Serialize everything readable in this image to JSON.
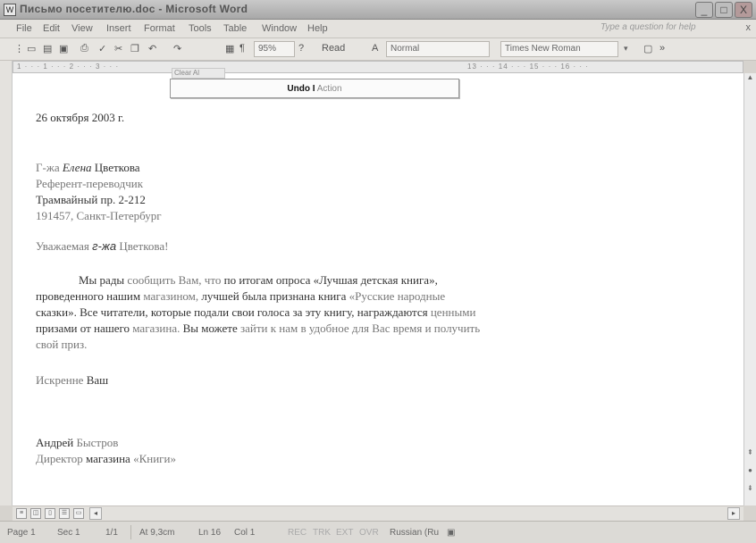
{
  "window": {
    "title": "Письмо посетителю.doc - Microsoft Word",
    "min": "_",
    "max": "□",
    "close": "X"
  },
  "menu": {
    "items": [
      "File",
      "Edit",
      "View",
      "Insert",
      "Format",
      "Tools",
      "Table",
      "Window",
      "Help"
    ],
    "help_placeholder": "Type a question for help",
    "close_glyph": "x"
  },
  "toolbar": {
    "zoom": "95%",
    "read_label": "Read",
    "style": "Normal",
    "font": "Times New Roman",
    "paragraph_mark": "¶"
  },
  "ruler": {
    "left_text": "1 · · · 1 · · · 2 · · · 3 · · ·",
    "right_text": "13 · · · 14 · · · 15 · · · 16 · · ·"
  },
  "undo_dropdown": {
    "caption": "Clear Al",
    "bold_text": "Undo I",
    "light_text": "Action"
  },
  "document": {
    "date": "26 октября 2003 г.",
    "recipient_prefix": "Г-жа",
    "recipient_first": "Елена",
    "recipient_last": "Цветкова",
    "position": "Референт-переводчик",
    "street": "Трамвайный пр. 2-212",
    "city": "191457, Санкт-Петербург",
    "salutation_a": "Уважаемая",
    "salutation_b": "г-жа",
    "salutation_c": "Цветкова!",
    "p1_a": "Мы рады",
    "p1_b": "сообщить Вам, что",
    "p1_c": "по итогам опроса «Лучшая детская книга»,",
    "p2_a": "проведенного нашим",
    "p2_b": "магазином,",
    "p2_c": "лучшей была признана книга",
    "p2_d": "«Русские народные",
    "p3_a": "сказки». Все читатели, которые подали свои голоса за эту книгу, награждаются",
    "p3_b": "ценными",
    "p4_a": "призами от нашего",
    "p4_b": "магазина.",
    "p4_c": "Вы можете",
    "p4_d": "зайти к нам в удобное для Вас время и получить",
    "p5": "свой приз.",
    "closing_a": "Искренне",
    "closing_b": "Ваш",
    "sign_first": "Андрей",
    "sign_last": "Быстров",
    "title_a": "Директор",
    "title_b": "магазина",
    "title_c": "«Книги»"
  },
  "statusbar": {
    "page": "Page 1",
    "sec": "Sec 1",
    "pages": "1/1",
    "at": "At 9,3cm",
    "ln": "Ln 16",
    "col": "Col 1",
    "rec": "REC",
    "trk": "TRK",
    "ext": "EXT",
    "ovr": "OVR",
    "lang": "Russian (Ru"
  }
}
